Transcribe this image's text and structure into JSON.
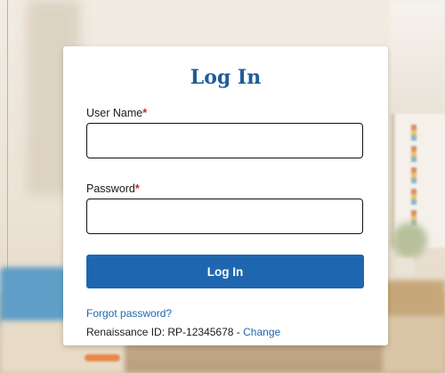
{
  "login": {
    "title": "Log In",
    "username_label": "User Name",
    "password_label": "Password",
    "required_marker": "*",
    "username_value": "",
    "password_value": "",
    "submit_label": "Log In",
    "forgot_password_label": "Forgot password?",
    "renaissance_id_prefix": "Renaissance ID: ",
    "renaissance_id": "RP-12345678",
    "separator": " - ",
    "change_label": "Change"
  },
  "colors": {
    "title": "#1f5c99",
    "button": "#1e67b0",
    "link": "#1e67b0",
    "required": "#c62828"
  },
  "background": {
    "description_icon": "classroom-background"
  }
}
